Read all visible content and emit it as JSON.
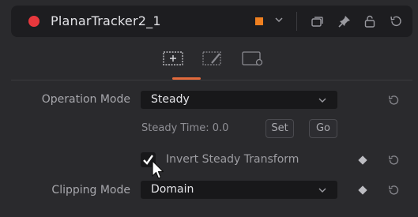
{
  "header": {
    "title": "PlanarTracker2_1",
    "rec_color": "#e8383d",
    "swatch_color": "#f08020",
    "icons": [
      "color-dropdown-chevron-icon",
      "versions-icon",
      "pin-icon",
      "lock-icon",
      "reset-all-icon"
    ]
  },
  "tabs": {
    "items": [
      "tab-controls",
      "tab-paint",
      "tab-settings"
    ],
    "active": "tab-controls",
    "accent": "#e36a3c"
  },
  "controls": {
    "operation_mode": {
      "label": "Operation Mode",
      "value": "Steady"
    },
    "steady_time": {
      "label": "Steady Time: 0.0",
      "set_label": "Set",
      "go_label": "Go"
    },
    "invert_steady": {
      "label": "Invert Steady Transform",
      "checked": true
    },
    "clipping_mode": {
      "label": "Clipping Mode",
      "value": "Domain"
    }
  }
}
